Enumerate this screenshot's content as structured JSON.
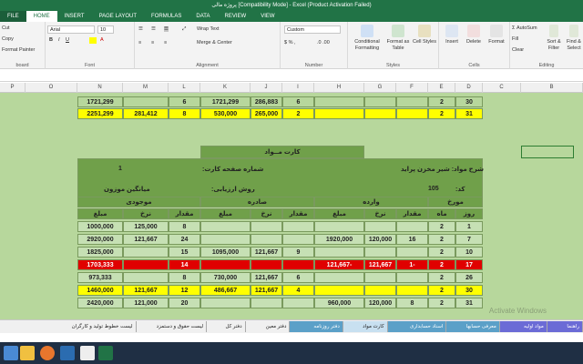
{
  "window": {
    "title": "پروژه مالی [Compatibility Mode] - Excel (Product Activation Failed)"
  },
  "ribbon_tabs": [
    "FILE",
    "HOME",
    "INSERT",
    "PAGE LAYOUT",
    "FORMULAS",
    "DATA",
    "REVIEW",
    "VIEW"
  ],
  "clipboard": {
    "cut": "Cut",
    "copy": "Copy",
    "painter": "Format Painter",
    "label": "board"
  },
  "font": {
    "name": "Arial",
    "size": "10",
    "label": "Font"
  },
  "alignment": {
    "wrap": "Wrap Text",
    "merge": "Merge & Center",
    "label": "Alignment"
  },
  "number": {
    "format": "Custom",
    "label": "Number"
  },
  "styles": {
    "conditional": "Conditional Formatting",
    "table": "Format as Table",
    "cell": "Cell Styles",
    "label": "Styles"
  },
  "cells": {
    "insert": "Insert",
    "delete": "Delete",
    "format": "Format",
    "label": "Cells"
  },
  "editing": {
    "autosum": "AutoSum",
    "fill": "Fill",
    "clear": "Clear",
    "sort": "Sort & Filter",
    "find": "Find & Select",
    "label": "Editing"
  },
  "columns": [
    "P",
    "O",
    "N",
    "M",
    "L",
    "K",
    "J",
    "I",
    "H",
    "G",
    "F",
    "E",
    "D",
    "C",
    "B"
  ],
  "top_rows": [
    {
      "N": "1721,299",
      "L": "6",
      "K": "1721,299",
      "J": "286,883",
      "I": "6",
      "E": "2",
      "D": "30"
    },
    {
      "N": "2251,299",
      "M": "281,412",
      "L": "8",
      "K": "530,000",
      "J": "265,000",
      "I": "2",
      "E": "2",
      "D": "31"
    }
  ],
  "card": {
    "title": "کارت مــواد",
    "material": "شرح مواد: شیر مخزن پراید",
    "card_no_label": "شماره صفحه کارت:",
    "card_no": "1",
    "code_label": "کد:",
    "code": "105",
    "method_label": "روش ارزیابی:",
    "method": "میانگین موزون",
    "h_stock": "موجودی",
    "h_out": "صادره",
    "h_in": "وارده",
    "h_date": "مورخ",
    "sub": {
      "amount": "مبلغ",
      "rate": "نرخ",
      "qty": "مقدار",
      "month": "ماه",
      "day": "روز"
    }
  },
  "rows": [
    {
      "stock_amt": "1000,000",
      "stock_rate": "125,000",
      "stock_qty": "8",
      "out_amt": "",
      "out_rate": "",
      "out_qty": "",
      "in_amt": "",
      "in_rate": "",
      "in_qty": "",
      "month": "2",
      "day": "1",
      "style": "grn"
    },
    {
      "stock_amt": "2920,000",
      "stock_rate": "121,667",
      "stock_qty": "24",
      "out_amt": "",
      "out_rate": "",
      "out_qty": "",
      "in_amt": "1920,000",
      "in_rate": "120,000",
      "in_qty": "16",
      "month": "2",
      "day": "7",
      "style": "grn"
    },
    {
      "stock_amt": "1825,000",
      "stock_rate": "",
      "stock_qty": "15",
      "out_amt": "1095,000",
      "out_rate": "121,667",
      "out_qty": "9",
      "in_amt": "",
      "in_rate": "",
      "in_qty": "",
      "month": "2",
      "day": "10",
      "style": "grn"
    },
    {
      "stock_amt": "1703,333",
      "stock_rate": "",
      "stock_qty": "14",
      "out_amt": "",
      "out_rate": "",
      "out_qty": "",
      "in_amt": "121,667-",
      "in_rate": "121,667",
      "in_qty": "1-",
      "month": "2",
      "day": "17",
      "style": "red"
    },
    {
      "stock_amt": "973,333",
      "stock_rate": "",
      "stock_qty": "8",
      "out_amt": "730,000",
      "out_rate": "121,667",
      "out_qty": "6",
      "in_amt": "",
      "in_rate": "",
      "in_qty": "",
      "month": "2",
      "day": "26",
      "style": "grn"
    },
    {
      "stock_amt": "1460,000",
      "stock_rate": "121,667",
      "stock_qty": "12",
      "out_amt": "486,667",
      "out_rate": "121,667",
      "out_qty": "4",
      "in_amt": "",
      "in_rate": "",
      "in_qty": "",
      "month": "2",
      "day": "30",
      "style": "yel"
    },
    {
      "stock_amt": "2420,000",
      "stock_rate": "121,000",
      "stock_qty": "20",
      "out_amt": "",
      "out_rate": "",
      "out_qty": "",
      "in_amt": "960,000",
      "in_rate": "120,000",
      "in_qty": "8",
      "month": "2",
      "day": "31",
      "style": "grn"
    }
  ],
  "sheet_tabs": [
    "راهنما",
    "مواد اولیه",
    "معرفی حسابها",
    "اسناد حسابداری",
    "کارت مواد",
    "دفتر روزنامه",
    "دفتر معین",
    "دفتر کل",
    "لیست حقوق و دستمزد",
    "لیست خطوط تولید و کارگران"
  ],
  "watermark": "Activate Windows"
}
